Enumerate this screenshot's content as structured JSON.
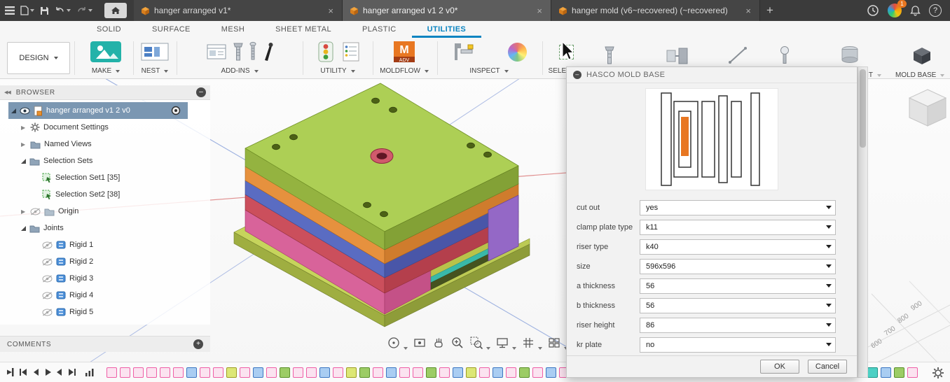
{
  "titlebar": {
    "tabs": [
      {
        "label": "hanger arranged v1*"
      },
      {
        "label": "hanger arranged v1 2 v0*"
      },
      {
        "label": "hanger mold (v6~recovered) (~recovered)"
      }
    ],
    "notification_count": "1",
    "help_label": "?"
  },
  "ribbon": {
    "design_label": "DESIGN",
    "tabs": [
      "SOLID",
      "SURFACE",
      "MESH",
      "SHEET METAL",
      "PLASTIC",
      "UTILITIES"
    ],
    "active_tab": "UTILITIES",
    "groups": {
      "make": "MAKE",
      "nest": "NEST",
      "addins": "ADD-INS",
      "utility": "UTILITY",
      "moldflow": "MOLDFLOW",
      "inspect": "INSPECT",
      "select": "SELECT",
      "ent": "ENT",
      "moldbase": "MOLD BASE"
    },
    "moldflow_icon_letter": "M",
    "moldflow_badge": "ADV"
  },
  "browser": {
    "header": "BROWSER",
    "root_label": "hanger arranged v1 2 v0",
    "items": [
      {
        "label": "Document Settings"
      },
      {
        "label": "Named Views"
      },
      {
        "label": "Selection Sets"
      },
      {
        "label": "Selection Set1 [35]"
      },
      {
        "label": "Selection Set2 [38]"
      },
      {
        "label": "Origin"
      },
      {
        "label": "Joints"
      },
      {
        "label": "Rigid 1"
      },
      {
        "label": "Rigid 2"
      },
      {
        "label": "Rigid 3"
      },
      {
        "label": "Rigid 4"
      },
      {
        "label": "Rigid 5"
      }
    ],
    "comments_label": "COMMENTS"
  },
  "dialog": {
    "title": "HASCO MOLD BASE",
    "accent_color": "#e87722",
    "fields": [
      {
        "label": "cut out",
        "value": "yes"
      },
      {
        "label": "clamp plate type",
        "value": "k11"
      },
      {
        "label": "riser type",
        "value": "k40"
      },
      {
        "label": "size",
        "value": "596x596"
      },
      {
        "label": "a thickness",
        "value": "56"
      },
      {
        "label": "b thickness",
        "value": "56"
      },
      {
        "label": "riser height",
        "value": "86"
      },
      {
        "label": "kr plate",
        "value": "no"
      }
    ],
    "ok_label": "OK",
    "cancel_label": "Cancel"
  },
  "viewport": {
    "axis_labels": [
      "900",
      "800",
      "700",
      "600"
    ],
    "model_colors": {
      "top_plate": "#adcf55",
      "plate_orange": "#e6913e",
      "plate_blue": "#5a6cc2",
      "plate_red": "#cb4f5c",
      "ejector_housing": "#d8639a",
      "bottom_plate": "#9fae41",
      "support_pillar": "#9468c6",
      "ejector_plate": "#39b8a8"
    }
  },
  "timeline": {
    "icons": [
      "pink",
      "pink",
      "pink",
      "pink",
      "pink",
      "pink",
      "blue",
      "pink",
      "pink",
      "yellow",
      "pink",
      "blue",
      "pink",
      "green",
      "pink",
      "pink",
      "blue",
      "pink",
      "yellow",
      "green",
      "pink",
      "blue",
      "pink",
      "pink",
      "green",
      "pink",
      "blue",
      "yellow",
      "pink",
      "blue",
      "pink",
      "green",
      "pink",
      "blue",
      "pink"
    ],
    "icons_right": [
      "teal",
      "blue",
      "green",
      "pink"
    ]
  }
}
